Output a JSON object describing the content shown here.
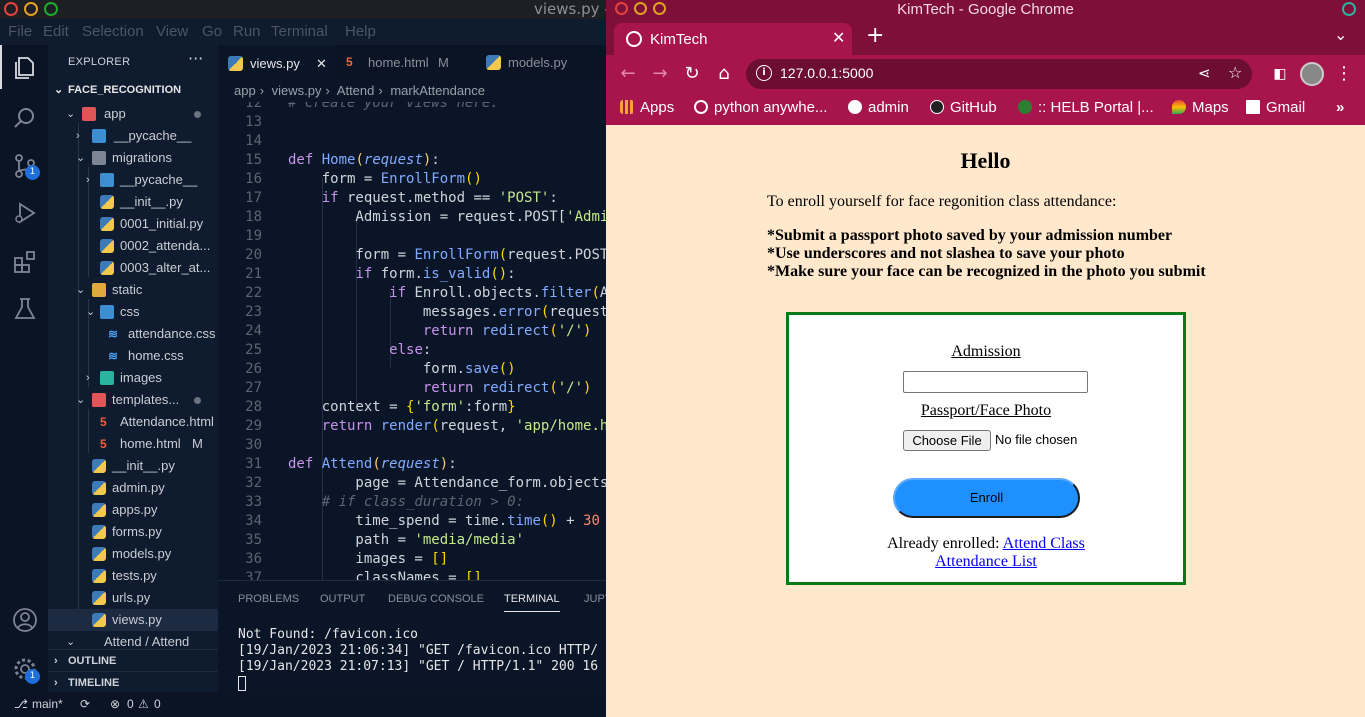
{
  "vscode": {
    "title": "views.py - F",
    "menu": [
      "File",
      "Edit",
      "Selection",
      "View",
      "Go",
      "Run",
      "Terminal",
      "Help"
    ],
    "explorer_label": "EXPLORER",
    "project": "FACE_RECOGNITION",
    "tree": [
      {
        "label": "app",
        "mod": ""
      },
      {
        "label": "__pycache__",
        "mod": ""
      },
      {
        "label": "migrations",
        "mod": ""
      },
      {
        "label": "__pycache__",
        "mod": ""
      },
      {
        "label": "__init__.py",
        "mod": ""
      },
      {
        "label": "0001_initial.py",
        "mod": ""
      },
      {
        "label": "0002_attenda...",
        "mod": ""
      },
      {
        "label": "0003_alter_at...",
        "mod": ""
      },
      {
        "label": "static",
        "mod": ""
      },
      {
        "label": "css",
        "mod": ""
      },
      {
        "label": "attendance.css",
        "mod": ""
      },
      {
        "label": "home.css",
        "mod": ""
      },
      {
        "label": "images",
        "mod": ""
      },
      {
        "label": "templates...",
        "mod": ""
      },
      {
        "label": "Attendance.html",
        "mod": ""
      },
      {
        "label": "home.html",
        "mod": "M"
      },
      {
        "label": "__init__.py",
        "mod": ""
      },
      {
        "label": "admin.py",
        "mod": ""
      },
      {
        "label": "apps.py",
        "mod": ""
      },
      {
        "label": "forms.py",
        "mod": ""
      },
      {
        "label": "models.py",
        "mod": ""
      },
      {
        "label": "tests.py",
        "mod": ""
      },
      {
        "label": "urls.py",
        "mod": ""
      },
      {
        "label": "views.py",
        "mod": ""
      },
      {
        "label": "Attend / Attend",
        "mod": ""
      }
    ],
    "outline_label": "OUTLINE",
    "timeline_label": "TIMELINE",
    "tabs": [
      {
        "label": "views.py",
        "mod": ""
      },
      {
        "label": "home.html",
        "mod": "M"
      },
      {
        "label": "models.py",
        "mod": ""
      }
    ],
    "breadcrumb": [
      "app",
      "views.py",
      "Attend",
      "markAttendance"
    ],
    "panel_tabs": [
      "PROBLEMS",
      "OUTPUT",
      "DEBUG CONSOLE",
      "TERMINAL",
      "JUPY"
    ],
    "terminal": [
      "Not Found: /favicon.ico",
      "[19/Jan/2023 21:06:34] \"GET /favicon.ico HTTP/",
      "[19/Jan/2023 21:07:13] \"GET / HTTP/1.1\" 200 16"
    ],
    "status": {
      "branch": "main*",
      "problems": "0",
      "warnings": "0"
    },
    "badges": {
      "scm": "1",
      "settings": "1"
    }
  },
  "chrome": {
    "window_title": "KimTech - Google Chrome",
    "tab_title": "KimTech",
    "url": "127.0.0.1:5000",
    "bookmarks": [
      "Apps",
      "python anywhe...",
      "admin",
      "GitHub",
      ":: HELB Portal |...",
      "Maps",
      "Gmail"
    ],
    "page": {
      "heading": "Hello",
      "intro": "To enroll yourself for face regonition class attendance:",
      "rules": [
        "*Submit a passport photo saved by your admission number",
        "*Use underscores and not slashea to save your photo",
        "*Make sure your face can be recognized in the photo you submit"
      ],
      "admission_label": "Admission",
      "photo_label": "Passport/Face Photo",
      "choose_file": "Choose File",
      "no_file": "No file chosen",
      "enroll": "Enroll",
      "already": "Already enrolled:",
      "attend_link": "Attend Class",
      "list_link": "Attendance List"
    }
  },
  "colors": {
    "chrome_accent": "#a8154c",
    "form_border": "#0b7a16",
    "enroll_button": "#1e90ff",
    "page_bg": "#ffe8cc"
  }
}
